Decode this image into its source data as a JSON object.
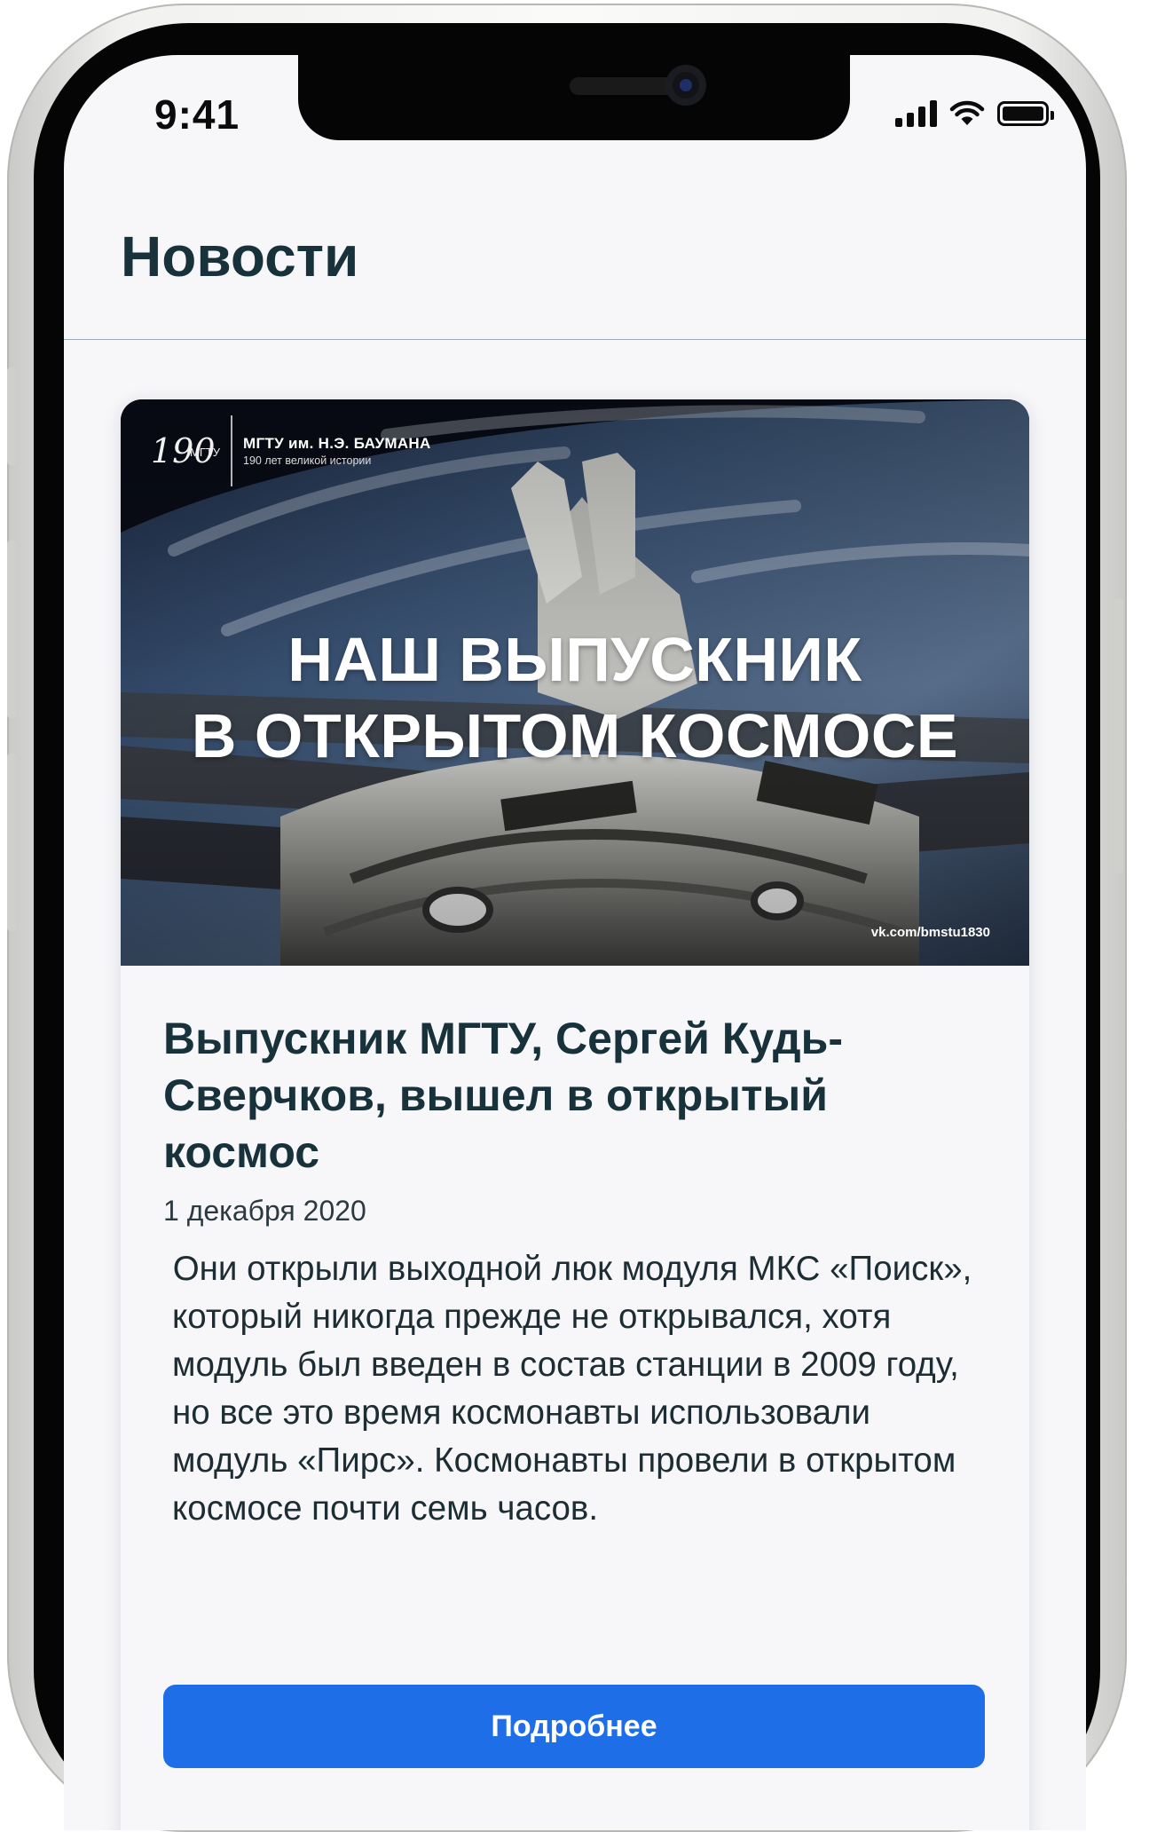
{
  "status_bar": {
    "time": "9:41",
    "icons": [
      "signal-icon",
      "wifi-icon",
      "battery-icon"
    ]
  },
  "header": {
    "title": "Новости"
  },
  "news_card": {
    "image": {
      "logo_mark": "190",
      "logo_mark_small": "МГТУ",
      "logo_title": "МГТУ им. Н.Э. БАУМАНА",
      "logo_subtitle": "190 лет великой истории",
      "headline_line1": "НАШ ВЫПУСКНИК",
      "headline_line2": "В ОТКРЫТОМ КОСМОСЕ",
      "credit": "vk.com/bmstu1830"
    },
    "title": "Выпускник МГТУ, Сергей Кудь-Сверчков, вышел в открытый космос",
    "date": "1 декабря 2020",
    "text": " Они открыли выходной люк модуля МКС «Поиск», который никогда прежде не открывался, хотя модуль был введен в состав станции в 2009 году, но все это время космонавты использовали модуль «Пирс». Космонавты провели в открытом космосе почти семь часов.",
    "button_label": "Подробнее"
  },
  "colors": {
    "accent": "#1e6ee8",
    "title_text": "#17323a",
    "background": "#f7f7fa"
  }
}
